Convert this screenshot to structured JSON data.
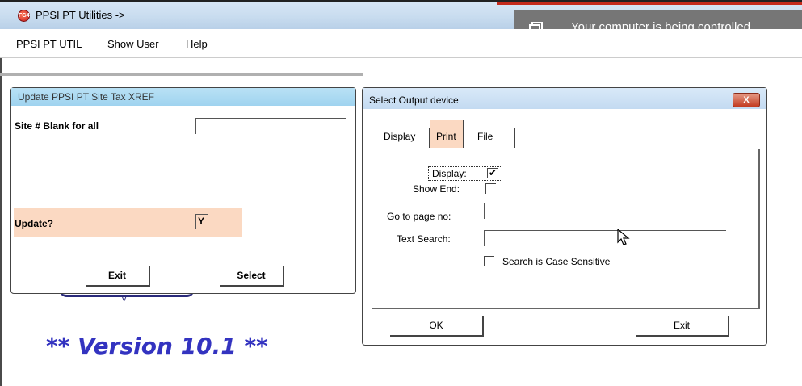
{
  "window": {
    "title": "PPSI PT Utilities ->",
    "app_icon_text": "FG4"
  },
  "toast": {
    "message": "Your computer is being controlled"
  },
  "menu": {
    "items": [
      "PPSI PT UTIL",
      "Show User",
      "Help"
    ]
  },
  "update_dialog": {
    "title": "Update PPSI PT Site Tax XREF",
    "site_label": "Site # Blank for all",
    "site_value": "",
    "update_label": "Update?",
    "update_value": "Y",
    "exit_label": "Exit",
    "select_label": "Select",
    "partial_glyph": "V"
  },
  "version_text": "** Version 10.1 **",
  "output_dialog": {
    "title": "Select Output device",
    "close_label": "X",
    "tabs": [
      "Display",
      "Print",
      "File"
    ],
    "active_tab": "Print",
    "display_label": "Display:",
    "display_checked": "✔",
    "show_end_label": "Show End:",
    "goto_label": "Go to page no:",
    "goto_value": "",
    "search_label": "Text Search:",
    "search_value": "",
    "case_label": "Search is Case Sensitive",
    "ok_label": "OK",
    "exit_label": "Exit"
  },
  "colors": {
    "highlight": "#fbd9c2",
    "version_text": "#3333c0",
    "dialog_title_blue": "#9fd3ef"
  }
}
